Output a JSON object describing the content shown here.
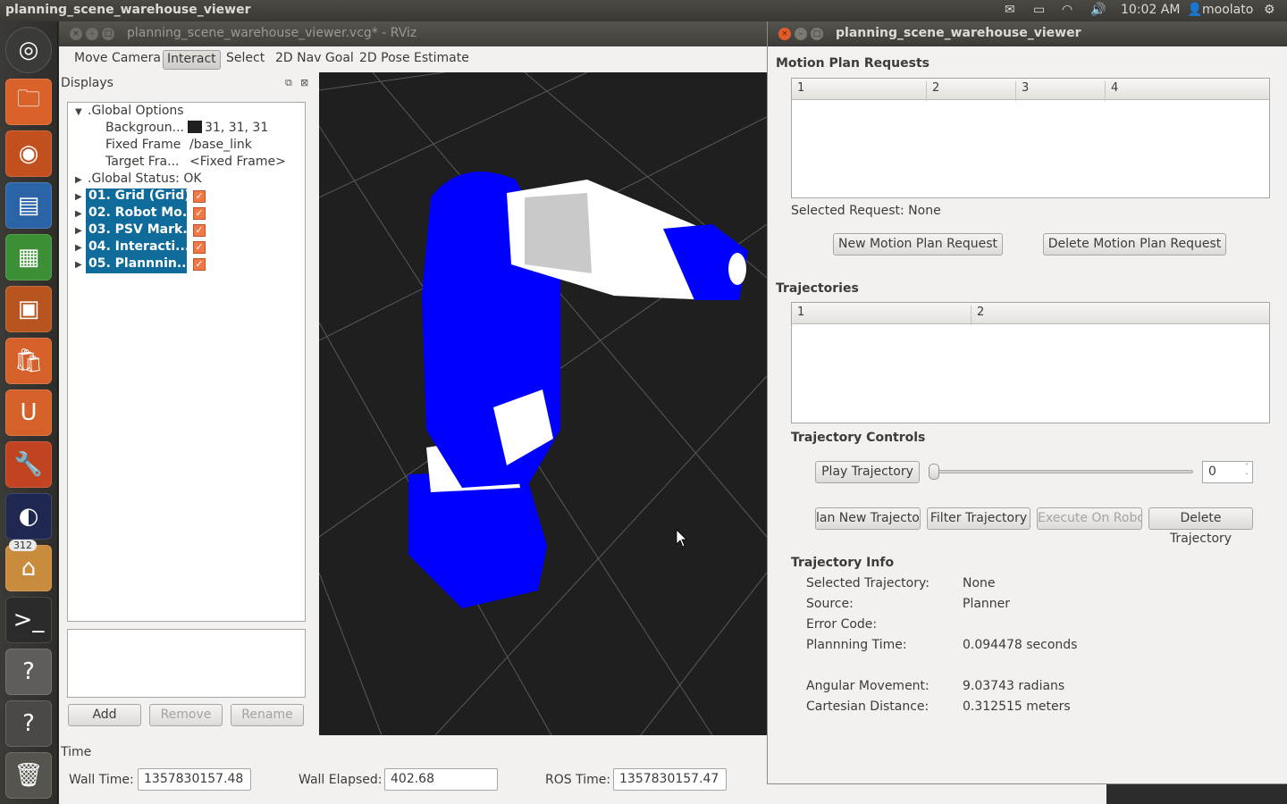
{
  "top_panel": {
    "app_title": "planning_scene_warehouse_viewer",
    "time": "10:02 AM",
    "user": "moolato"
  },
  "launcher": {
    "badge": "312"
  },
  "rviz": {
    "window_title": "planning_scene_warehouse_viewer.vcg* - RViz",
    "tools": [
      "Move Camera",
      "Interact",
      "Select",
      "2D Nav Goal",
      "2D Pose Estimate"
    ],
    "active_tool": "Interact",
    "displays_header": "Displays",
    "tree": {
      "global_options": ".Global Options",
      "background_label": "Backgroun...",
      "background_value": "31, 31, 31",
      "fixed_frame_label": "Fixed Frame",
      "fixed_frame_value": "/base_link",
      "target_frame_label": "Target Fra...",
      "target_frame_value": "<Fixed Frame>",
      "global_status": ".Global Status: OK",
      "displays": [
        "01. Grid (Grid)",
        "02. Robot Mo...",
        "03. PSV Mark...",
        "04. Interacti...",
        "05. Plannnin..."
      ]
    },
    "buttons": {
      "add": "Add",
      "remove": "Remove",
      "rename": "Rename"
    },
    "time_panel": {
      "header": "Time",
      "wall_time_label": "Wall Time:",
      "wall_time": "1357830157.48",
      "wall_elapsed_label": "Wall Elapsed:",
      "wall_elapsed": "402.68",
      "ros_time_label": "ROS Time:",
      "ros_time": "1357830157.47"
    },
    "colors": {
      "background": "#1f1f1f",
      "robot": "#0000ff",
      "robot_links": "#ffffff"
    }
  },
  "psv": {
    "window_title": "planning_scene_warehouse_viewer",
    "motion_plan_requests": "Motion Plan Requests",
    "mpr_columns": [
      "1",
      "2",
      "3",
      "4"
    ],
    "selected_request": "Selected Request: None",
    "new_request_button": "New Motion Plan Request",
    "delete_request_button": "Delete Motion Plan Request",
    "trajectories": "Trajectories",
    "traj_columns": [
      "1",
      "2"
    ],
    "trajectory_controls": "Trajectory Controls",
    "play_button": "Play Trajectory",
    "slider_value": 0,
    "spin_value": "0",
    "plan_new_button": "lan New Trajector",
    "filter_button": "Filter Trajectory",
    "execute_button": "Execute On Robot",
    "delete_traj_button": "Delete Trajectory",
    "trajectory_info": "Trajectory Info",
    "info": [
      {
        "label": "Selected Trajectory:",
        "value": "None"
      },
      {
        "label": "Source:",
        "value": "Planner"
      },
      {
        "label": "Error Code:",
        "value": ""
      },
      {
        "label": "Plannning Time:",
        "value": "0.094478 seconds"
      },
      {
        "label": "Angular Movement:",
        "value": "9.03743 radians"
      },
      {
        "label": "Cartesian Distance:",
        "value": "0.312515 meters"
      }
    ]
  }
}
